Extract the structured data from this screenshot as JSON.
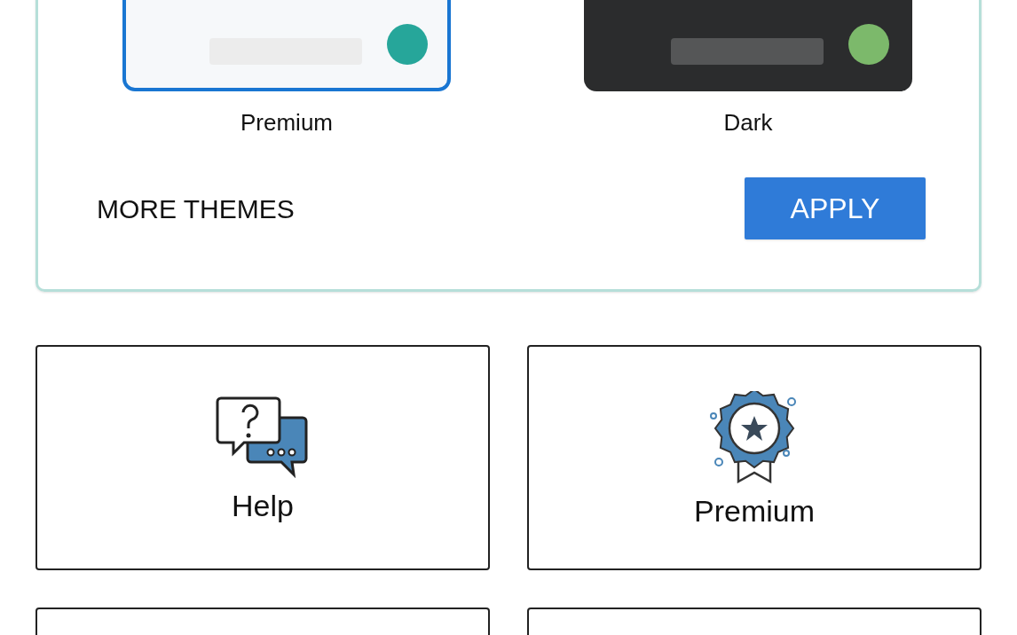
{
  "themes": {
    "options": [
      {
        "name": "Premium",
        "kind": "light",
        "color": "#26a69a",
        "selected": true
      },
      {
        "name": "Dark",
        "kind": "dark",
        "color": "#7cb96b",
        "selected": false
      }
    ],
    "more_button": "MORE THEMES",
    "apply_button": "APPLY"
  },
  "tiles": [
    {
      "kind": "help",
      "label": "Help"
    },
    {
      "kind": "premium",
      "label": "Premium"
    },
    {
      "kind": "blank"
    },
    {
      "kind": "blank"
    }
  ]
}
